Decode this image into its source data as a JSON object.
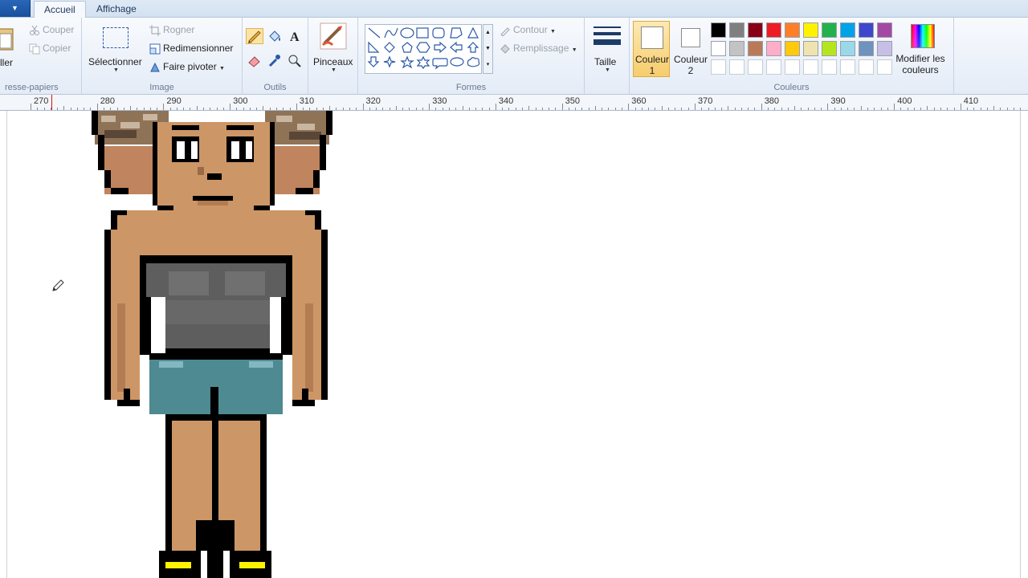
{
  "tabs": {
    "active": "Accueil",
    "other": "Affichage"
  },
  "clipboard": {
    "paste_label": "ller",
    "cut": "Couper",
    "copy": "Copier",
    "title": "resse-papiers"
  },
  "image": {
    "select": "Sélectionner",
    "crop": "Rogner",
    "resize": "Redimensionner",
    "rotate": "Faire pivoter",
    "title": "Image"
  },
  "tools": {
    "title": "Outils"
  },
  "brushes": {
    "label": "Pinceaux"
  },
  "shapes": {
    "outline": "Contour",
    "fill": "Remplissage",
    "title": "Formes"
  },
  "size": {
    "label": "Taille"
  },
  "colors": {
    "color1": "Couleur 1",
    "color2": "Couleur 2",
    "edit": "Modifier les couleurs",
    "title": "Couleurs",
    "palette_row1": [
      "#000000",
      "#7f7f7f",
      "#880015",
      "#ed1c24",
      "#ff7f27",
      "#fff200",
      "#22b14c",
      "#00a2e8",
      "#3f48cc",
      "#a349a4"
    ],
    "palette_row2": [
      "#ffffff",
      "#c3c3c3",
      "#b97a57",
      "#ffaec9",
      "#ffc90e",
      "#efe4b0",
      "#b5e61d",
      "#99d9ea",
      "#7092be",
      "#c8bfe7"
    ]
  },
  "ruler": {
    "ticks": [
      "270",
      "280",
      "290",
      "300",
      "310",
      "320",
      "330",
      "340",
      "350",
      "360",
      "370",
      "380",
      "390",
      "400",
      "410"
    ]
  }
}
